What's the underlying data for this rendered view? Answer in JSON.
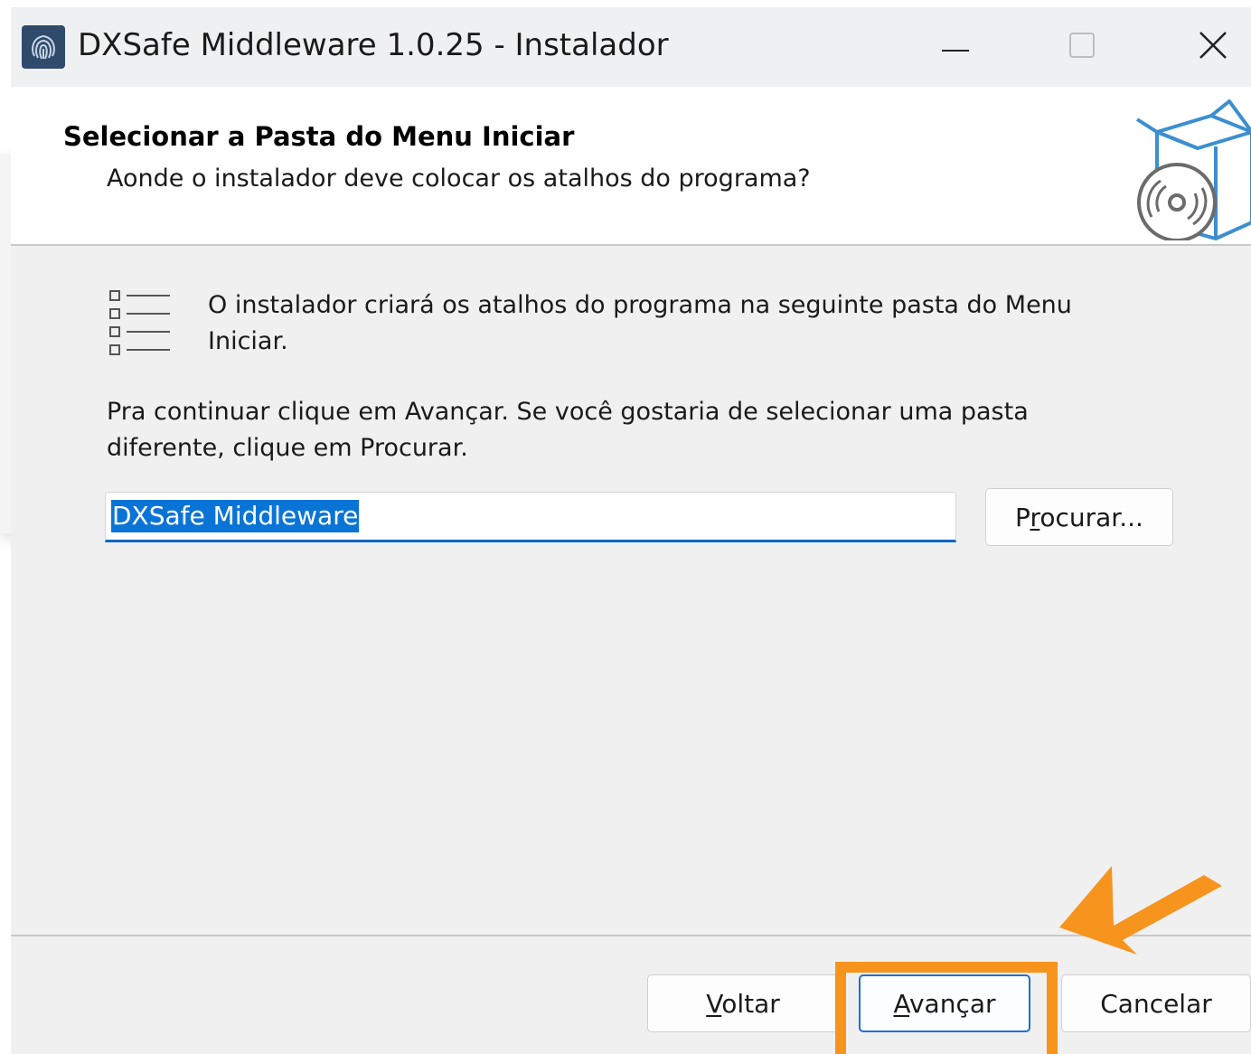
{
  "window": {
    "title": "DXSafe Middleware 1.0.25 - Instalador",
    "icons": {
      "app": "fingerprint-icon",
      "minimize": "minimize-icon",
      "maximize": "maximize-icon",
      "close": "close-icon"
    }
  },
  "header": {
    "title": "Selecionar a Pasta do Menu Iniciar",
    "subtitle": "Aonde o instalador deve colocar os atalhos do programa?",
    "icon": "install-box-disc-icon"
  },
  "body": {
    "info_icon": "list-icon",
    "info_text": "O instalador criará os atalhos do programa na seguinte pasta do Menu Iniciar.",
    "continue_text": "Pra continuar clique em Avançar. Se você gostaria de selecionar uma pasta diferente, clique em Procurar.",
    "folder_value": "DXSafe Middleware",
    "browse_button": {
      "label": "Procurar...",
      "pre": "P",
      "mnemonic": "r",
      "post": "ocurar..."
    }
  },
  "footer": {
    "back_button": {
      "label": "Voltar",
      "mnemonic": "V",
      "rest": "oltar"
    },
    "next_button": {
      "label": "Avançar",
      "mnemonic": "A",
      "rest": "vançar"
    },
    "cancel_button": {
      "label": "Cancelar"
    }
  },
  "annotation": {
    "highlight_color": "#f7941d",
    "arrow_icon": "orange-arrow-icon"
  }
}
